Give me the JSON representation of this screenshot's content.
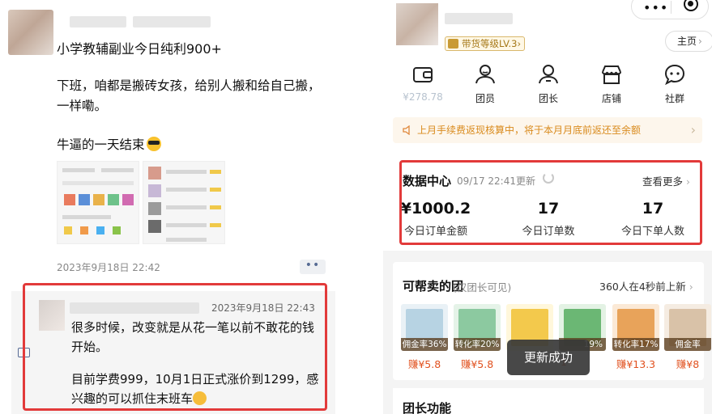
{
  "left": {
    "post": {
      "title": "小学教辅副业今日纯利900+",
      "paragraph": "下班，咱都是搬砖女孩，给别人搬和给自己搬，一样嘞。",
      "closing": "牛逼的一天结束",
      "timestamp": "2023年9月18日 22:42",
      "more_label": "••"
    },
    "comment": {
      "timestamp": "2023年9月18日 22:43",
      "text1": "很多时候，改变就是从花一笔以前不敢花的钱开始。",
      "text2": "目前学费999，10月1日正式涨价到1299，感兴趣的可以抓住末班车"
    }
  },
  "right": {
    "level_badge": "带货等级LV.3",
    "level_badge_suffix": "›",
    "capsule_dots": "•••",
    "home_label": "主页",
    "nav": [
      {
        "icon": "wallet-icon",
        "label": "¥278.78"
      },
      {
        "icon": "member-icon",
        "label": "团员"
      },
      {
        "icon": "leader-icon",
        "label": "团长"
      },
      {
        "icon": "shop-icon",
        "label": "店铺"
      },
      {
        "icon": "community-icon",
        "label": "社群"
      }
    ],
    "notice": "上月手续费返现核算中，将于本月月底前返还至余额",
    "notice_arrow": "›",
    "data_center": {
      "title": "数据中心",
      "updated": "09/17 22:41更新",
      "more": "查看更多",
      "stats": [
        {
          "value": "¥1000.2",
          "label": "今日订单金额"
        },
        {
          "value": "17",
          "label": "今日订单数"
        },
        {
          "value": "17",
          "label": "今日下单人数"
        }
      ]
    },
    "groups": {
      "title": "可帮卖的团",
      "subtitle": "(仅团长可见)",
      "recent": "360人在4秒前上新",
      "products": [
        {
          "rate": "佣金率36%",
          "earn": "赚¥5.8",
          "color": "#b7d3e3"
        },
        {
          "rate": "转化率20%",
          "earn": "赚¥5.8",
          "color": "#8cc9a0"
        },
        {
          "rate": "",
          "earn": "",
          "color": "#f3c94c"
        },
        {
          "rate": "19%",
          "earn": "1",
          "color": "#6bb774"
        },
        {
          "rate": "转化率17%",
          "earn": "赚¥13.3",
          "color": "#e8a35a"
        },
        {
          "rate": "佣金率",
          "earn": "赚¥8",
          "color": "#d9c2a8"
        }
      ]
    },
    "toast": "更新成功",
    "functions_title": "团长功能"
  },
  "colors": {
    "accent_red": "#e23a3a",
    "earn_orange": "#e1511f",
    "notice_text": "#d98a1c",
    "link_blue": "#576b95"
  }
}
